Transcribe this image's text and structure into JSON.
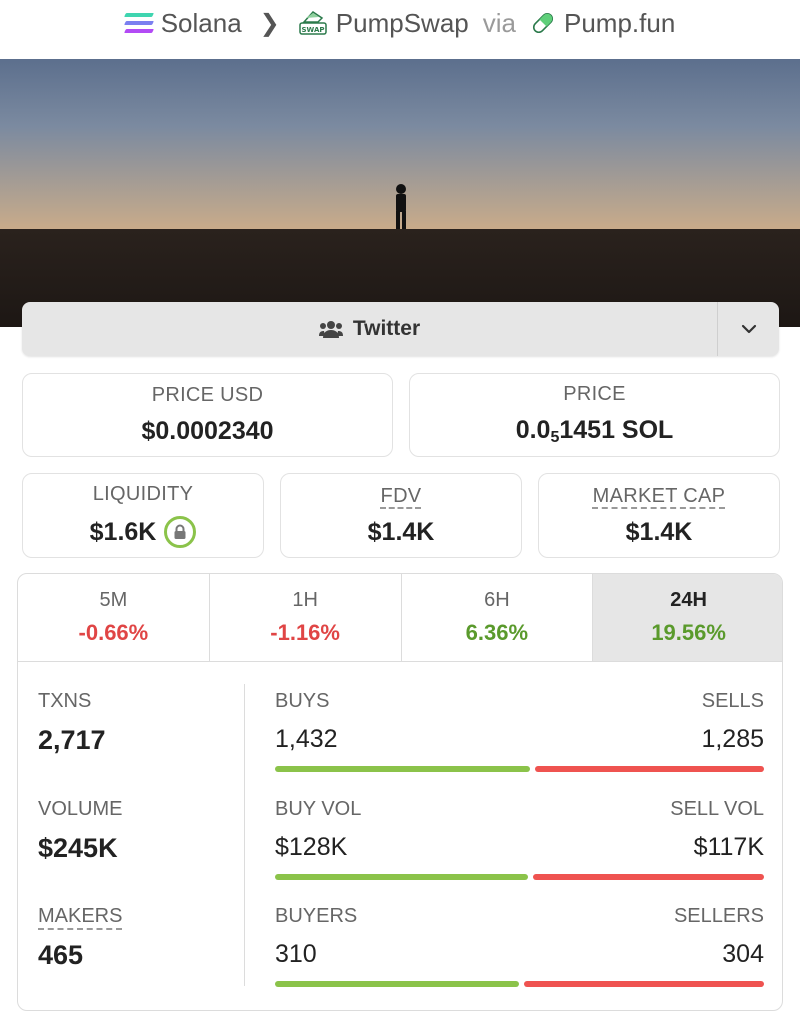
{
  "breadcrumb": {
    "chain": "Solana",
    "dex": "PumpSwap",
    "via": "via",
    "launchpad": "Pump.fun"
  },
  "banner": {
    "icon": "silhouette-at-sunset-image"
  },
  "socials": {
    "twitter_label": "Twitter"
  },
  "stats": {
    "price_usd": {
      "label": "PRICE USD",
      "value": "$0.0002340"
    },
    "price_native": {
      "label": "PRICE",
      "prefix": "0.0",
      "sub": "5",
      "suffix": "1451 SOL"
    },
    "liquidity": {
      "label": "LIQUIDITY",
      "value": "$1.6K"
    },
    "fdv": {
      "label": "FDV",
      "value": "$1.4K"
    },
    "market_cap": {
      "label": "MARKET CAP",
      "value": "$1.4K"
    }
  },
  "timeframes": [
    {
      "label": "5M",
      "change": "-0.66%"
    },
    {
      "label": "1H",
      "change": "-1.16%"
    },
    {
      "label": "6H",
      "change": "6.36%"
    },
    {
      "label": "24H",
      "change": "19.56%"
    }
  ],
  "active_timeframe": "24H",
  "txns": {
    "txns": {
      "label": "TXNS",
      "value": "2,717"
    },
    "volume": {
      "label": "VOLUME",
      "value": "$245K"
    },
    "makers": {
      "label": "MAKERS",
      "value": "465"
    },
    "buys_sells": {
      "left_label": "BUYS",
      "right_label": "SELLS",
      "left_value": "1,432",
      "right_value": "1,285",
      "left_num": 1432,
      "right_num": 1285
    },
    "vol_split": {
      "left_label": "BUY VOL",
      "right_label": "SELL VOL",
      "left_value": "$128K",
      "right_value": "$117K",
      "left_num": 128,
      "right_num": 117
    },
    "buyers_sellers": {
      "left_label": "BUYERS",
      "right_label": "SELLERS",
      "left_value": "310",
      "right_value": "304",
      "left_num": 310,
      "right_num": 304
    }
  },
  "colors": {
    "positive": "#5a9a2c",
    "negative": "#e04545",
    "buy_bar": "#8bc34a",
    "sell_bar": "#ef5350"
  }
}
